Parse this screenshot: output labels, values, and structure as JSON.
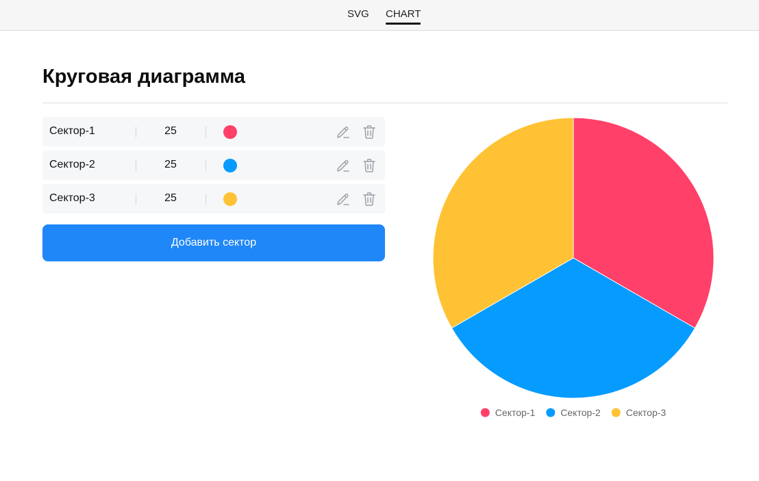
{
  "nav": {
    "tabs": [
      {
        "label": "SVG",
        "active": false
      },
      {
        "label": "CHART",
        "active": true
      }
    ]
  },
  "page": {
    "title": "Круговая диаграмма"
  },
  "sectors": [
    {
      "name": "Сектор-1",
      "value": "25",
      "color": "#ff4069"
    },
    {
      "name": "Сектор-2",
      "value": "25",
      "color": "#059bff"
    },
    {
      "name": "Сектор-3",
      "value": "25",
      "color": "#ffc234"
    }
  ],
  "actions": {
    "edit_icon": "pencil-icon",
    "delete_icon": "trash-icon",
    "add_label": "Добавить сектор"
  },
  "colors": {
    "accent": "#1f87f8",
    "row_background": "#f5f7f9"
  },
  "chart_data": {
    "type": "pie",
    "categories": [
      "Сектор-1",
      "Сектор-2",
      "Сектор-3"
    ],
    "values": [
      25,
      25,
      25
    ],
    "colors": [
      "#ff4069",
      "#059bff",
      "#ffc234"
    ],
    "legend": "bottom"
  }
}
